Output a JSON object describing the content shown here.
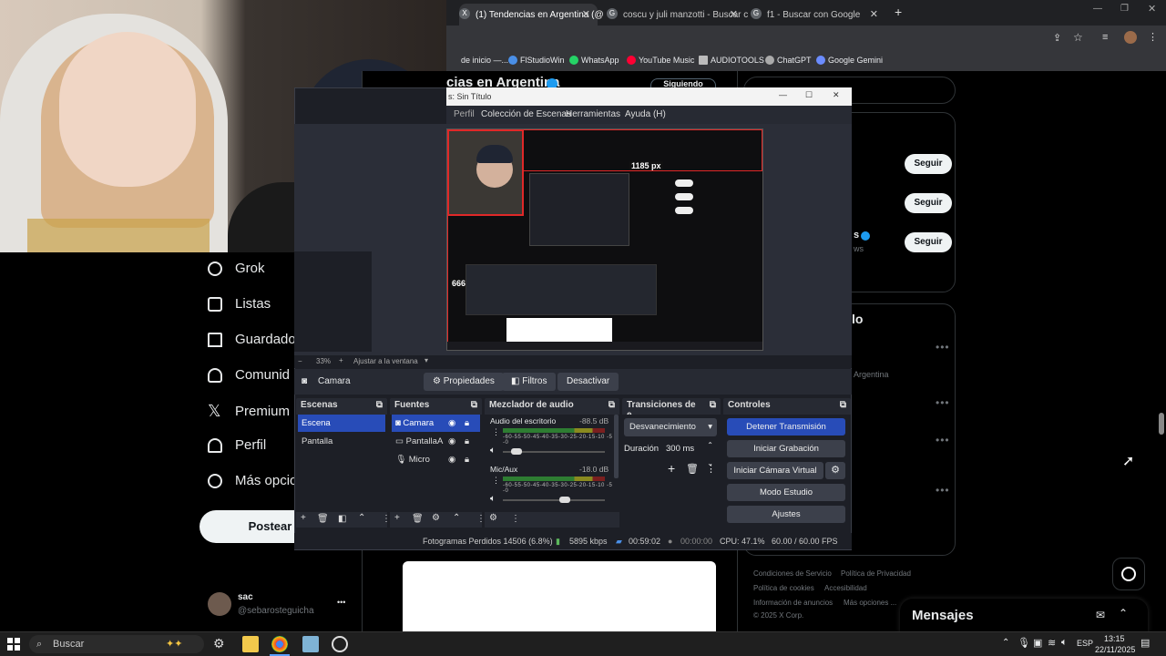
{
  "browser": {
    "tabs": [
      {
        "title": "(1) Tendencias en Argentina (@",
        "favicon": "X"
      },
      {
        "title": "coscu y juli manzotti - Buscar c",
        "favicon": "G"
      },
      {
        "title": "f1 - Buscar con Google",
        "favicon": "G"
      }
    ],
    "new_tab": "+",
    "bookmarks": [
      "de inicio —...",
      "FlStudioWin",
      "WhatsApp",
      "YouTube Music",
      "AUDIOTOOLS",
      "ChatGPT",
      "Google Gemini"
    ]
  },
  "x": {
    "page_title": "cias en Argentina",
    "follow_top": "Siguiendo",
    "nav": [
      {
        "label": "Grok",
        "icon": "grok-icon"
      },
      {
        "label": "Listas",
        "icon": "list-icon"
      },
      {
        "label": "Guardados",
        "icon": "bookmark-icon"
      },
      {
        "label": "Comunid",
        "icon": "communities-icon"
      },
      {
        "label": "Premium",
        "icon": "x-logo-icon"
      },
      {
        "label": "Perfil",
        "icon": "profile-icon"
      },
      {
        "label": "Más opcio",
        "icon": "more-icon"
      }
    ],
    "post_button": "Postear",
    "profile": {
      "name": "sac",
      "handle": "@sebarosteguicha",
      "more": "•••"
    },
    "follow_buttons": [
      "Seguir",
      "Seguir",
      "Seguir"
    ],
    "side_heading": "lo",
    "side_location": "Argentina",
    "side_partial": "s",
    "side_partial2": "ws",
    "footer": [
      "Condiciones de Servicio",
      "Política de Privacidad",
      "Política de cookies",
      "Accesibilidad",
      "Información de anuncios",
      "Más opciones ...",
      "© 2025 X Corp."
    ],
    "messages": "Mensajes"
  },
  "obs": {
    "title": "s: Sin Título",
    "menu": [
      "Perfil",
      "Colección de Escenas",
      "Herramientas",
      "Ayuda (H)"
    ],
    "preview": {
      "width_label": "1185 px",
      "height_label": "666 px"
    },
    "zoom": "33%",
    "fit": "Ajustar a la ventana",
    "source_bar": {
      "name": "Camara",
      "buttons": [
        "Propiedades",
        "Filtros",
        "Desactivar"
      ]
    },
    "scenes": {
      "title": "Escenas",
      "items": [
        "Escena",
        "Pantalla"
      ]
    },
    "sources": {
      "title": "Fuentes",
      "items": [
        "Camara",
        "PantallaA",
        "Micro"
      ]
    },
    "mixer": {
      "title": "Mezclador de audio",
      "channels": [
        {
          "name": "Audio del escritorio",
          "db": "-88.5 dB",
          "volume": 0.08
        },
        {
          "name": "Mic/Aux",
          "db": "-18.0 dB",
          "volume": 0.55
        }
      ],
      "scale": "-60-55-50-45-40-35-30-25-20-15-10 -5 -0"
    },
    "transitions": {
      "title": "Transiciones de e...",
      "selected": "Desvanecimiento",
      "duration_label": "Duración",
      "duration": "300 ms"
    },
    "controls": {
      "title": "Controles",
      "buttons": [
        "Detener Transmisión",
        "Iniciar Grabación",
        "Iniciar Cámara Virtual",
        "Modo Estudio",
        "Ajustes"
      ]
    },
    "status": {
      "dropped": "Fotogramas Perdidos 14506 (6.8%)",
      "bitrate": "5895 kbps",
      "live": "00:59:02",
      "rec": "00:00:00",
      "cpu": "CPU: 47.1%",
      "fps": "60.00 / 60.00 FPS"
    }
  },
  "taskbar": {
    "search": "Buscar",
    "lang": "ESP",
    "time": "13:15",
    "date": "22/11/2025"
  }
}
